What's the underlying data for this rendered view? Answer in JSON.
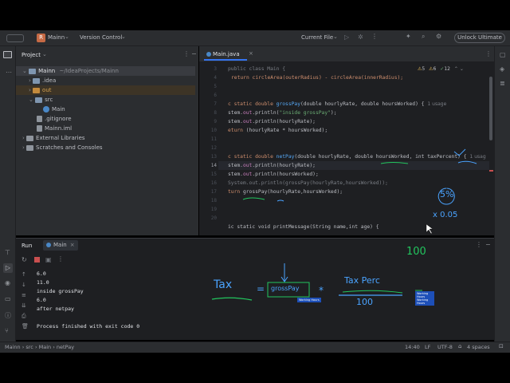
{
  "topbar": {
    "project_initial": "R",
    "project_name": "Mainn",
    "vcs_label": "Version Control",
    "run_config": "Current File",
    "unlock_label": "Unlock Ultimate"
  },
  "project_panel": {
    "title": "Project",
    "root_name": "Mainn",
    "root_path": "~/IdeaProjects/Mainn",
    "items": [
      {
        "label": "Mainn",
        "kind": "root"
      },
      {
        "label": ".idea",
        "kind": "folder"
      },
      {
        "label": "out",
        "kind": "folder-orange"
      },
      {
        "label": "src",
        "kind": "folder"
      },
      {
        "label": "Main",
        "kind": "class"
      },
      {
        "label": ".gitignore",
        "kind": "file"
      },
      {
        "label": "Mainn.iml",
        "kind": "file"
      },
      {
        "label": "External Libraries",
        "kind": "lib"
      },
      {
        "label": "Scratches and Consoles",
        "kind": "lib"
      }
    ]
  },
  "editor": {
    "tab_label": "Main.java",
    "warnings": "5",
    "weak_warnings": "6",
    "typos": "12",
    "line_numbers": [
      "3",
      "4",
      "5",
      "6",
      "7",
      "8",
      "9",
      "10",
      "11",
      "12",
      "13",
      "14",
      "15",
      "16",
      "17",
      "18",
      "19",
      "20"
    ],
    "lines": {
      "l3": "public class Main {",
      "l4": "return circleArea(outerRadius) - circleArea(innerRadius);",
      "l7_kw": "c static double ",
      "l7_fn": "grossPay",
      "l7_rest": "(double hourlyRate, double hoursWorked) {",
      "l7_hint": "1 usage",
      "l8_a": "stem.",
      "l8_f": "out",
      "l8_b": ".println(",
      "l8_s": "\"inside grossPay\"",
      "l8_c": ");",
      "l9_a": "stem.",
      "l9_f": "out",
      "l9_b": ".println(hourlyRate);",
      "l10_kw": "eturn",
      "l10_rest": " (hourlyRate * hoursWorked);",
      "l12_kw": "c static double ",
      "l12_fn": "netPay",
      "l12_rest": "(double hourlyRate, double hoursWorked, int taxPercent) {",
      "l12_hint": "1 usag",
      "l13_a": "stem.",
      "l13_f": "out",
      "l13_b": ".println(hourlyRate);",
      "l14_a": "stem.",
      "l14_f": "out",
      "l14_b": ".println(hoursWorked);",
      "l15": "System.out.println(grossPay(hourlyRate,hoursWorked));",
      "l16_kw": "turn",
      "l16_rest": " grossPay(hourlyRate,hoursWorked);",
      "l20": "ic static void printMessage(String name,int age) {"
    }
  },
  "run_panel": {
    "title": "Run",
    "tab_label": "Main",
    "output": [
      "6.0",
      "11.0",
      "inside grossPay",
      "6.0",
      "after netpay",
      "",
      "Process finished with exit code 0"
    ]
  },
  "annotations": {
    "tax": "Tax",
    "eq": "=",
    "gross": "grossPay",
    "times": "*",
    "tax_perc": "Tax Perc",
    "hundred": "100",
    "hundred_top": "100",
    "five_percent": "5%",
    "x005": "x 0.05",
    "tag1": "Working Hours",
    "tag2": "Working Hours Working Hours"
  },
  "statusbar": {
    "crumbs": [
      "Mainn",
      "src",
      "Main",
      "netPay"
    ],
    "position": "14:40",
    "line_sep": "LF",
    "encoding": "UTF-8",
    "indent": "4 spaces"
  },
  "colors": {
    "accent": "#3574f0",
    "annotation_blue": "#4aa3ff",
    "annotation_green": "#22c55e"
  }
}
